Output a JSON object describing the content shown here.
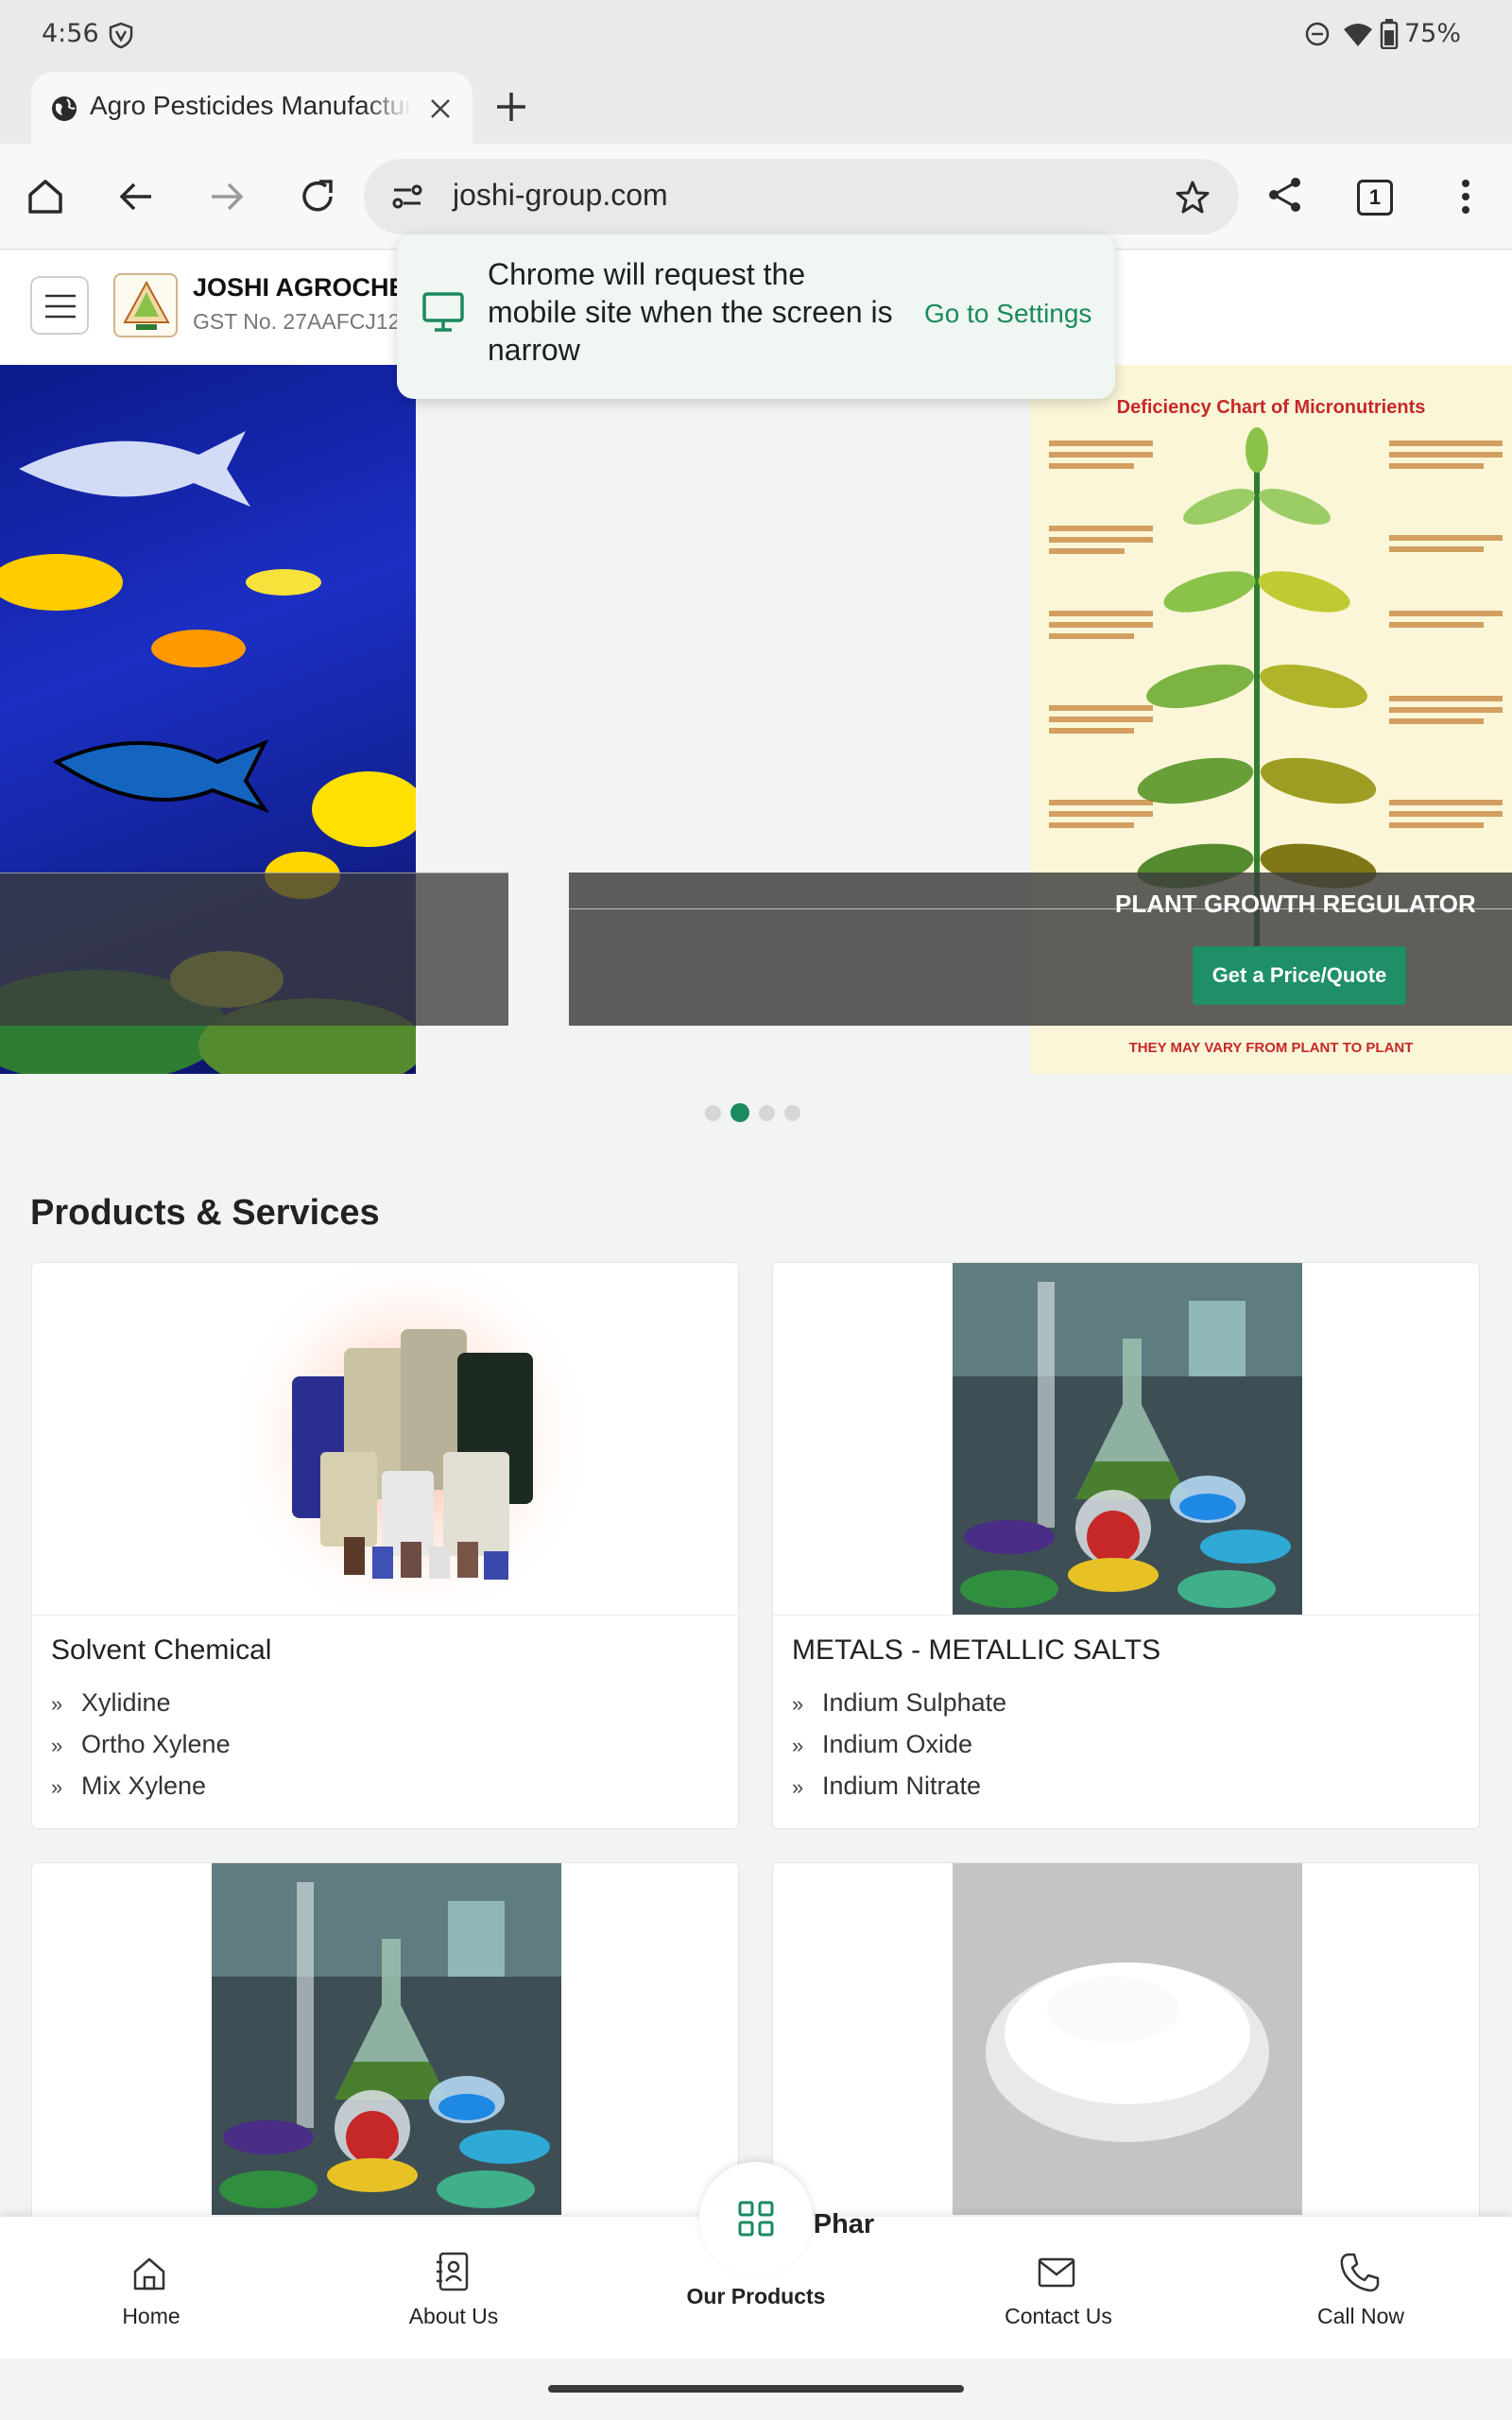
{
  "status_bar": {
    "time": "4:56",
    "battery": "75%"
  },
  "browser": {
    "tab_title": "Agro Pesticides Manufactur",
    "url": "joshi-group.com",
    "tab_count": "1"
  },
  "site": {
    "company_name": "JOSHI AGROCHE",
    "gst": "GST No. 27AAFCJ12"
  },
  "popup": {
    "message": [
      "Chrome will request the",
      "mobile site when the screen is",
      "narrow"
    ],
    "action": "Go to Settings"
  },
  "hero": {
    "slide_title": "PLANT GROWTH REGULATOR",
    "cta": "Get a Price/Quote",
    "chart_title": "Deficiency Chart of Micronutrients",
    "chart_footer": "THEY MAY VARY FROM PLANT TO PLANT",
    "dots": 4,
    "active_dot": 1
  },
  "products": {
    "heading": "Products & Services",
    "cards": [
      {
        "title": "Solvent Chemical",
        "items": [
          "Xylidine",
          "Ortho Xylene",
          "Mix Xylene"
        ]
      },
      {
        "title": "METALS - METALLIC SALTS",
        "items": [
          "Indium Sulphate",
          "Indium Oxide",
          "Indium Nitrate"
        ]
      }
    ],
    "partial_label": "Phar"
  },
  "bottom_nav": [
    {
      "label": "Home",
      "icon": "home-icon"
    },
    {
      "label": "About Us",
      "icon": "address-book-icon"
    },
    {
      "label": "Our Products",
      "icon": "grid-icon"
    },
    {
      "label": "Contact Us",
      "icon": "mail-icon"
    },
    {
      "label": "Call Now",
      "icon": "phone-icon"
    }
  ],
  "colors": {
    "accent": "#1a8a5f",
    "popup_bg": "#f0f6f1",
    "cta_bg": "#1e8f66"
  }
}
